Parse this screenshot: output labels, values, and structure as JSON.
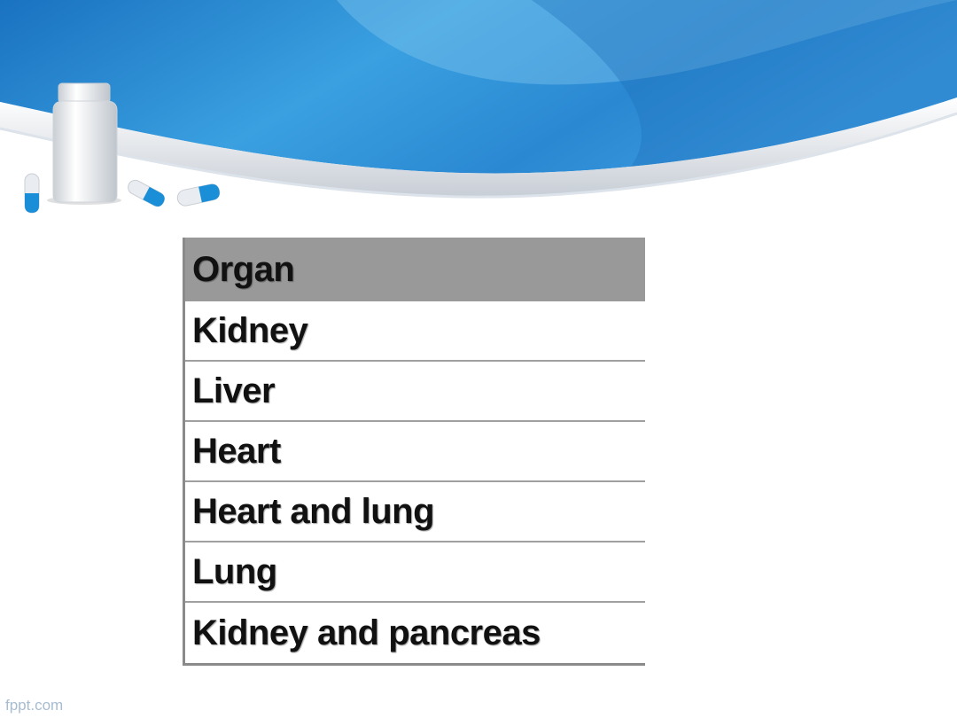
{
  "slide": {
    "table": {
      "header": "Organ",
      "rows": [
        "Kidney",
        "Liver",
        "Heart",
        "Heart and lung",
        "Lung",
        "Kidney and pancreas"
      ]
    },
    "footer_text": "fppt.com"
  },
  "theme": {
    "banner_blue": "#2f8fd6",
    "banner_dark_blue": "#1d6fb8",
    "header_gray": "#999999",
    "capsule_blue": "#1a8fd8"
  },
  "icons": [
    "pill-bottle-icon",
    "capsule-icon"
  ]
}
